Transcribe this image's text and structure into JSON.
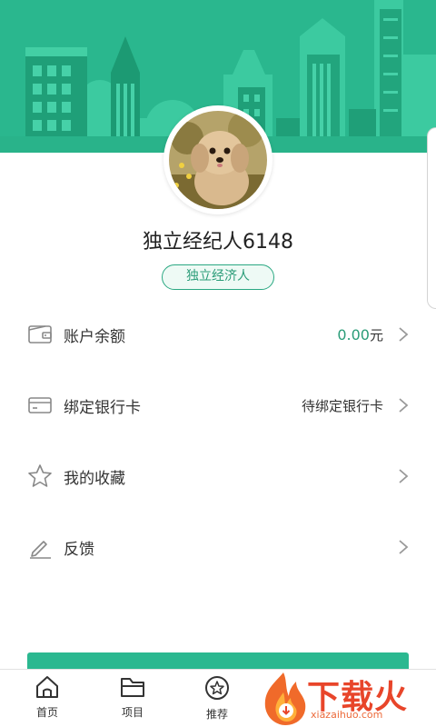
{
  "profile": {
    "name": "独立经纪人6148",
    "role": "独立经济人"
  },
  "menu": {
    "balance": {
      "label": "账户余额",
      "value": "0.00",
      "unit": "元",
      "icon": "wallet-icon"
    },
    "bank_card": {
      "label": "绑定银行卡",
      "value": "待绑定银行卡",
      "icon": "bank-card-icon"
    },
    "favorites": {
      "label": "我的收藏",
      "icon": "star-icon"
    },
    "feedback": {
      "label": "反馈",
      "icon": "pencil-icon"
    }
  },
  "bottom_nav": {
    "items": [
      {
        "label": "首页",
        "icon": "home-icon"
      },
      {
        "label": "项目",
        "icon": "folder-icon"
      },
      {
        "label": "推荐",
        "icon": "star-circle-icon"
      }
    ]
  },
  "watermark": {
    "text": "下载火",
    "url": "xiazaihuo.com"
  },
  "colors": {
    "brand_green": "#2bb890",
    "accent_text": "#2a9c78"
  }
}
